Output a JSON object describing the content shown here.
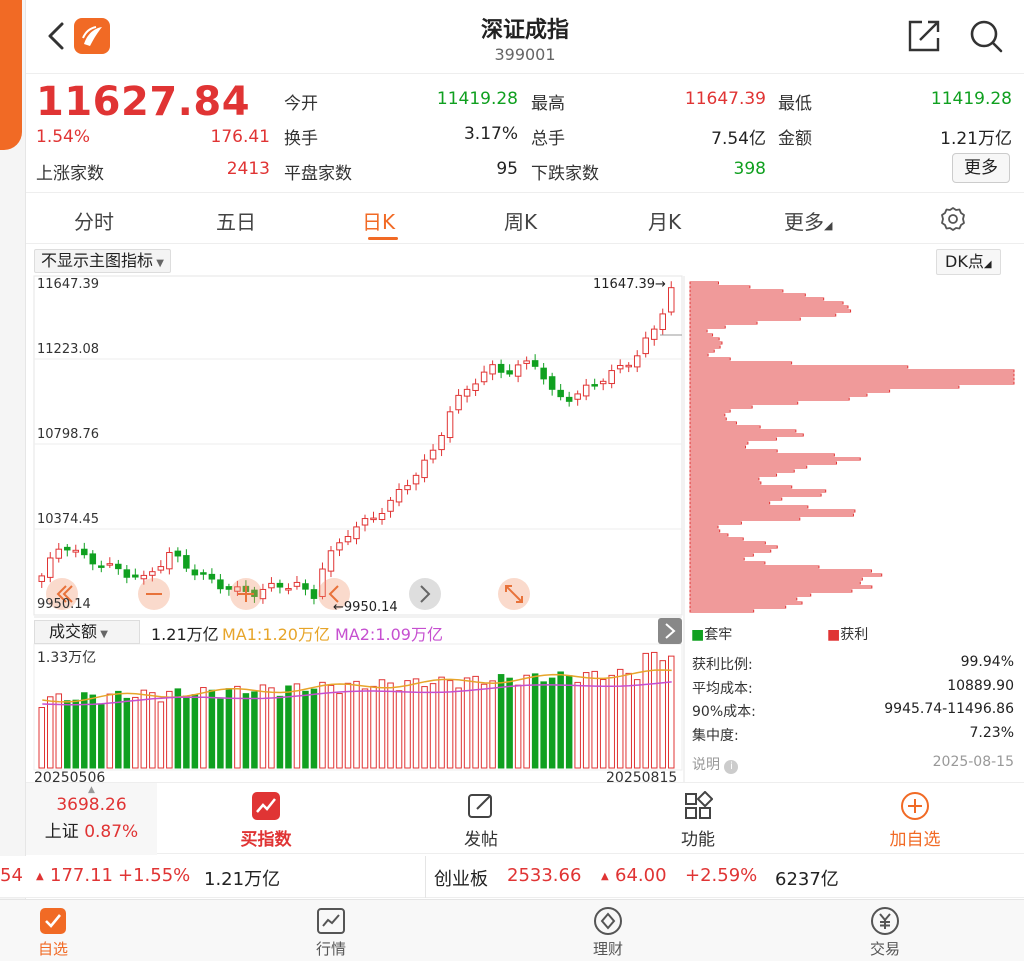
{
  "header": {
    "title": "深证成指",
    "code": "399001"
  },
  "quote": {
    "price": "11627.84",
    "change_pct": "1.54%",
    "change": "176.41",
    "open_label": "今开",
    "open": "11419.28",
    "high_label": "最高",
    "high": "11647.39",
    "low_label": "最低",
    "low": "11419.28",
    "turnover_label": "换手",
    "turnover": "3.17%",
    "volume_label": "总手",
    "volume": "7.54亿",
    "amount_label": "金额",
    "amount": "1.21万亿",
    "up_label": "上涨家数",
    "up": "2413",
    "flat_label": "平盘家数",
    "flat": "95",
    "down_label": "下跌家数",
    "down": "398",
    "more": "更多"
  },
  "tabs": [
    {
      "label": "分时"
    },
    {
      "label": "五日"
    },
    {
      "label": "日K"
    },
    {
      "label": "周K"
    },
    {
      "label": "月K"
    },
    {
      "label": "更多"
    }
  ],
  "chart": {
    "indicator_select": "不显示主图指标",
    "dk_button": "DK点",
    "price_ticks": [
      "11647.39",
      "11223.08",
      "10798.76",
      "10374.45",
      "9950.14"
    ],
    "max_annotation": "11647.39",
    "min_annotation": "9950.14",
    "volume_select": "成交额",
    "volume_total": "1.21万亿",
    "ma1": "MA1:1.20万亿",
    "ma2": "MA2:1.09万亿",
    "volume_max": "1.33万亿",
    "date_start": "20250506",
    "date_end": "20250815"
  },
  "chart_data": {
    "type": "candlestick",
    "x_range": [
      "20250506",
      "20250815"
    ],
    "ylim": [
      9950.14,
      11647.39
    ],
    "up_color": "#e03434",
    "down_color": "#10a020"
  },
  "chips": {
    "legend_trapped": "套牢",
    "legend_profit": "获利",
    "rows": [
      {
        "label": "获利比例:",
        "value": "99.94%"
      },
      {
        "label": "平均成本:",
        "value": "10889.90"
      },
      {
        "label": "90%成本:",
        "value": "9945.74-11496.86"
      },
      {
        "label": "集中度:",
        "value": "7.23%"
      }
    ],
    "note_label": "说明",
    "note_date": "2025-08-15"
  },
  "actions": {
    "mini_index_value": "3698.26",
    "mini_index_name": "上证",
    "mini_index_pct": "0.87%",
    "buy_index": "买指数",
    "post": "发帖",
    "functions": "功能",
    "add_watch": "加自选"
  },
  "ticker": {
    "left_partial": "54",
    "sz_change": "177.11",
    "sz_pct": "+1.55%",
    "sz_amount": "1.21万亿",
    "cyb_name": "创业板",
    "cyb_value": "2533.66",
    "cyb_change": "64.00",
    "cyb_pct": "+2.59%",
    "cyb_amount": "6237亿"
  },
  "nav": [
    {
      "label": "自选"
    },
    {
      "label": "行情"
    },
    {
      "label": "理财"
    },
    {
      "label": "交易"
    }
  ],
  "colors": {
    "accent": "#f16a25",
    "up": "#e03434",
    "down": "#10a020",
    "ma1": "#e7a52a",
    "ma2": "#c64fd0"
  }
}
